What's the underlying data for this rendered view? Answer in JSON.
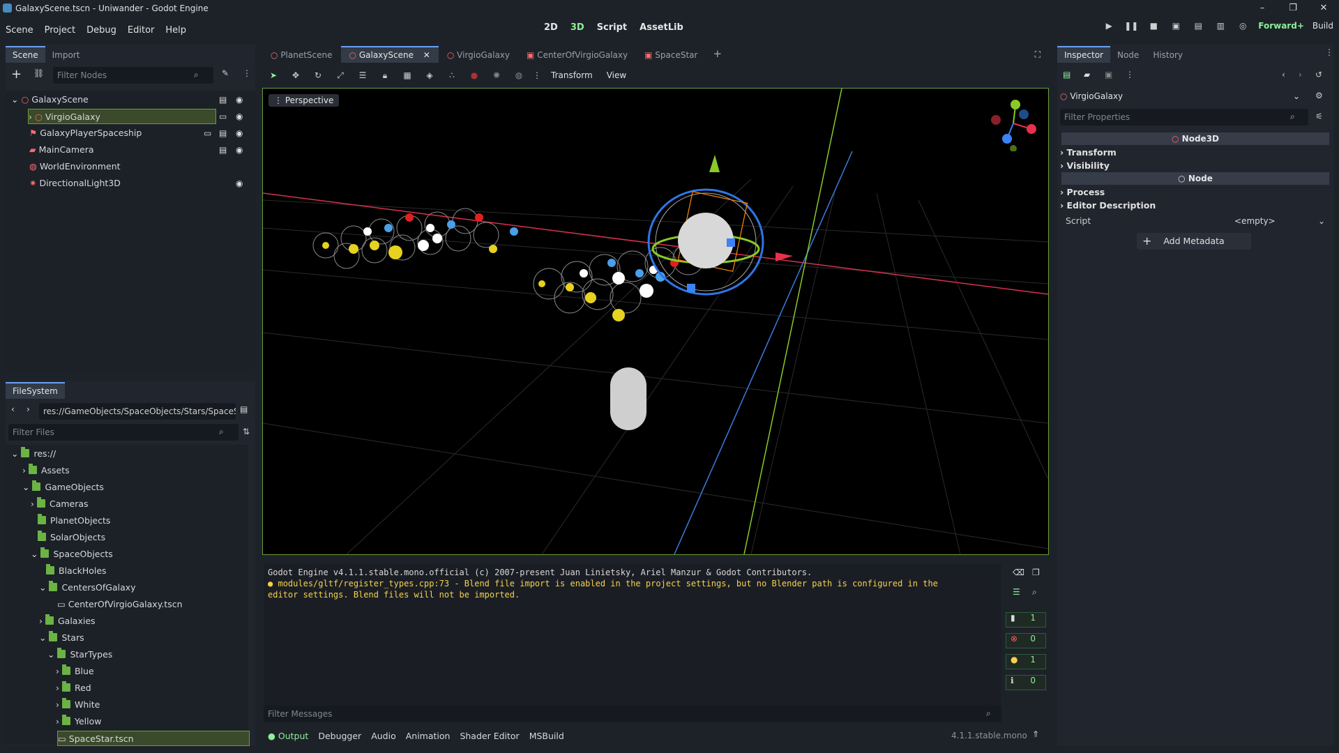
{
  "title": "GalaxyScene.tscn - Uniwander - Godot Engine",
  "menu": [
    "Scene",
    "Project",
    "Debug",
    "Editor",
    "Help"
  ],
  "workspaces": [
    "2D",
    "3D",
    "Script",
    "AssetLib"
  ],
  "renderer": "Forward+",
  "build": "Build",
  "scene_dock": {
    "tabs": [
      "Scene",
      "Import"
    ],
    "filter_placeholder": "Filter Nodes",
    "nodes": [
      "GalaxyScene",
      "VirgioGalaxy",
      "GalaxyPlayerSpaceship",
      "MainCamera",
      "WorldEnvironment",
      "DirectionalLight3D"
    ]
  },
  "filesystem": {
    "title": "FileSystem",
    "path": "res://GameObjects/SpaceObjects/Stars/SpaceSt",
    "filter_placeholder": "Filter Files",
    "items": [
      "res://",
      "Assets",
      "GameObjects",
      "Cameras",
      "PlanetObjects",
      "SolarObjects",
      "SpaceObjects",
      "BlackHoles",
      "CentersOfGalaxy",
      "CenterOfVirgioGalaxy.tscn",
      "Galaxies",
      "Stars",
      "StarTypes",
      "Blue",
      "Red",
      "White",
      "Yellow",
      "SpaceStar.tscn"
    ]
  },
  "editor_tabs": [
    "PlanetScene",
    "GalaxyScene",
    "VirgioGalaxy",
    "CenterOfVirgioGalaxy",
    "SpaceStar"
  ],
  "viewport": {
    "toolbar_menus": [
      "Transform",
      "View"
    ],
    "perspective": "Perspective"
  },
  "output": {
    "lines": [
      "Godot Engine v4.1.1.stable.mono.official (c) 2007-present Juan Linietsky, Ariel Manzur & Godot Contributors.",
      "modules/gltf/register_types.cpp:73 - Blend file import is enabled in the project settings, but no Blender path is configured in the",
      "editor settings. Blend files will not be imported."
    ],
    "filter_placeholder": "Filter Messages",
    "counts": [
      "1",
      "0",
      "1",
      "0"
    ]
  },
  "bottom_tabs": [
    "Output",
    "Debugger",
    "Audio",
    "Animation",
    "Shader Editor",
    "MSBuild"
  ],
  "version": "4.1.1.stable.mono",
  "inspector": {
    "tabs": [
      "Inspector",
      "Node",
      "History"
    ],
    "object": "VirgioGalaxy",
    "filter_placeholder": "Filter Properties",
    "class1": "Node3D",
    "sec1": [
      "Transform",
      "Visibility"
    ],
    "class2": "Node",
    "sec2": [
      "Process",
      "Editor Description"
    ],
    "script_label": "Script",
    "script_value": "<empty>",
    "add_metadata": "Add Metadata"
  },
  "colors": {
    "accent": "#8eef97",
    "selection": "#6c9d3b",
    "folder": "#6bb345",
    "warning": "#f6d04d",
    "error": "#ff5d5d"
  }
}
